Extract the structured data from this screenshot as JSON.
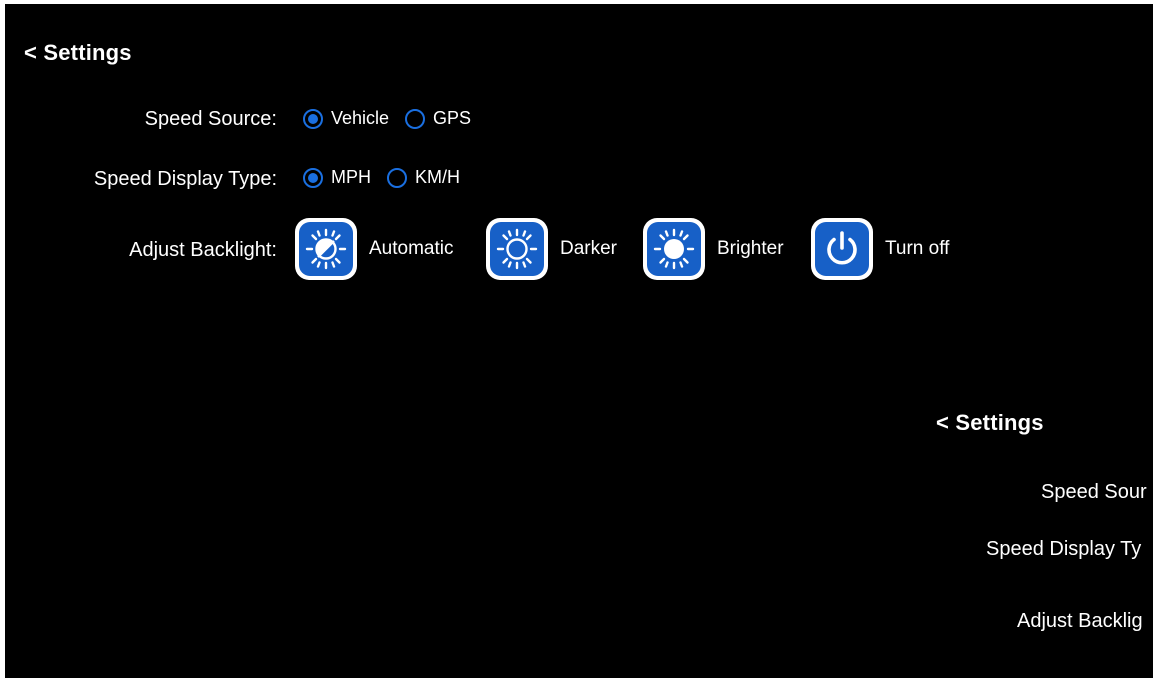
{
  "main": {
    "back_label": "< Settings",
    "speed_source": {
      "label": "Speed Source:",
      "options": [
        {
          "label": "Vehicle",
          "checked": true
        },
        {
          "label": "GPS",
          "checked": false
        }
      ]
    },
    "speed_display": {
      "label": "Speed Display Type:",
      "options": [
        {
          "label": "MPH",
          "checked": true
        },
        {
          "label": "KM/H",
          "checked": false
        }
      ]
    },
    "backlight": {
      "label": "Adjust Backlight:",
      "buttons": [
        {
          "label": "Automatic",
          "icon": "backlight-auto-icon"
        },
        {
          "label": "Darker",
          "icon": "sun-outline-icon"
        },
        {
          "label": "Brighter",
          "icon": "sun-filled-icon"
        },
        {
          "label": "Turn off",
          "icon": "power-icon"
        }
      ]
    }
  },
  "echo": {
    "back_label": "< Settings",
    "speed_source_label": "Speed Sour",
    "speed_display_label": "Speed Display Ty",
    "backlight_label": "Adjust Backlig"
  },
  "colors": {
    "background": "#000000",
    "accent": "#1a6fe0",
    "icon_fill": "#1760c7"
  }
}
